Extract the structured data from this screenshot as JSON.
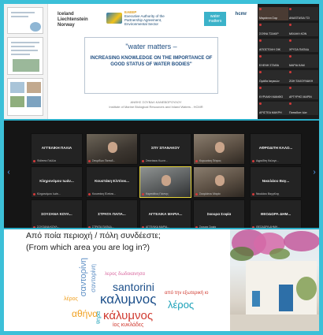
{
  "slide": {
    "logo_iceland": [
      "Iceland",
      "Liechtenstein",
      "Norway"
    ],
    "logo_eea": "Executive Authority of the Partnership Agreement, Environmental Sector",
    "logo_eea_top": "EAEEP",
    "logo_wm": [
      "water",
      "matters"
    ],
    "logo_hcmr": "hcmr",
    "title": "\"water matters –",
    "subtitle": "INCREASING KNOWLEDGE ON THE IMPORTANCE OF GOOD STATUS OF WATER BODIES\"",
    "author": [
      "ΑΝΘΗΣ ΣΟΥΒΑΛ ΚΑΝΕΒΟΡΟΥΛΟΥ",
      "Institute of Marine Biological Resources and Inland Waters - HCMR"
    ]
  },
  "strip_tiles": [
    "Μαριάννα Σαρ",
    "ANASTASIA ΤΣΙ",
    "ΣΟΦΙΑ ΤΣΑΚΙΡ",
    "ΜΙΧΑΗΛ ΚΟΝ",
    "ΑΠΟΣΤΟΛΗ ΟΙΚ",
    "ΧΡΥΣΑ ΠΑΠΑΔ",
    "ΕΛΕΝΗ ΣΤΑΘΑ",
    "ΜΑΡΙΑ ΚΑΜ",
    "Ομάδα Ιατρικών",
    "ΖΩΗ ΤΑΧΟΥΝΑΚΗ",
    "ΚΥΡΙΑΚΗ ΜΑΝΘΟ",
    "ΑΡΓΥΡΗΣ ΜΑΡΙΝ",
    "ΑΡΙΣΤΕΑ ΜΑΚΡΗ",
    "Παπαδοπ Ιώσ"
  ],
  "grid": [
    {
      "name": "ΑΓΓΕΛΙΚΗ ΠΑΛΙΑ",
      "label": "Φιλίππα Γκέλλα",
      "type": "name"
    },
    {
      "name": "",
      "label": "Σπυρίδων Παπαδ...",
      "type": "video"
    },
    {
      "name": "ΣΠΥ ΣΠΑΝΑΚΟΥ",
      "label": "Σπανάκου Κωνσ...",
      "type": "name"
    },
    {
      "name": "",
      "label": "Κορωνάκη Πέτρος",
      "type": "video2"
    },
    {
      "name": "ΑΦΡΟΔΙΤΗ ΚΑΛΟ...",
      "label": "Αφροδίτη Καλογε...",
      "type": "name"
    },
    {
      "name": "Κληρονόμου Ιωάν...",
      "label": "Κληρονόμου Ιωάν...",
      "type": "name"
    },
    {
      "name": "Κουστάκη Ελπίνικ...",
      "label": "Κουστάκη Ελπίνικ...",
      "type": "name"
    },
    {
      "name": "",
      "label": "Καρπάθιος Γιάννης",
      "type": "video3"
    },
    {
      "name": "",
      "label": "Σκαρλάτου Μαρία",
      "type": "video2"
    },
    {
      "name": "Νικολάου Βαγ...",
      "label": "Νικολάου Βαγγέλης",
      "type": "name"
    },
    {
      "name": "ΣΟΥΖΑΝΑ ΚΟΥΛ...",
      "label": "ΣΟΥΖΑΝΑ ΚΟΥΛ...",
      "type": "name"
    },
    {
      "name": "ΣΤΡΑΤΑ ΠΑΠΑ...",
      "label": "ΣΤΡΑΤΑ ΠΑΠΑΔ...",
      "type": "name"
    },
    {
      "name": "ΑΓΓΕΛΙΚΑ ΜΑΡΙΑ...",
      "label": "ΑΓΓΕΛΙΚΑ ΜΑΡΙΑ...",
      "type": "name"
    },
    {
      "name": "Σκουρα Σοφία",
      "label": "Σκουρα Σοφία",
      "type": "name"
    },
    {
      "name": "ΘΕΟΔΩΡΑ ΔΗΜ...",
      "label": "ΘΕΟΔΩΡΑ ΔΗΜΗ...",
      "type": "name"
    }
  ],
  "nav": {
    "prev": "‹",
    "next": "›"
  },
  "poll": {
    "question_gr": "Από ποία περιοχή / πόλη συνδέεστε;",
    "question_en": "(From which area you are log in?)"
  },
  "cloud": [
    {
      "text": "σαντορίνη",
      "color": "#5c8ec4"
    },
    {
      "text": "σαντορίνη",
      "color": "#5c8ec4"
    },
    {
      "text": "λέρος",
      "color": "#f0a020"
    },
    {
      "text": "λερος δωδεκανησα",
      "color": "#d96aa0"
    },
    {
      "text": "santorini",
      "color": "#1c4f8a"
    },
    {
      "text": "από την εξωτερική ιο",
      "color": "#d03a30"
    },
    {
      "text": "καλυμνος",
      "color": "#1c4f8a"
    },
    {
      "text": "λέρος",
      "color": "#1aa0b8"
    },
    {
      "text": "αθήνα",
      "color": "#f0a020"
    },
    {
      "text": "κάλυμνος",
      "color": "#d03a30"
    },
    {
      "text": "ίος κυκλάδες",
      "color": "#d03a30"
    },
    {
      "text": "θήρα",
      "color": "#1aa0b8"
    }
  ]
}
